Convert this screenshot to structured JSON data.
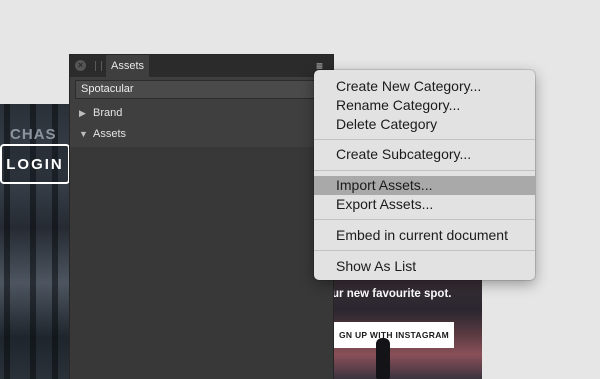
{
  "background": {
    "left_sign": "CHAS",
    "login_label": "LOGIN",
    "tagline": "ur new favourite spot.",
    "instagram_button": "GN UP WITH INSTAGRAM"
  },
  "panel": {
    "tab_label": "Assets",
    "category": "Spotacular",
    "items": [
      {
        "label": "Brand",
        "expanded": false
      },
      {
        "label": "Assets",
        "expanded": true
      }
    ],
    "colors": {
      "panel_bg": "#3f3f3f",
      "header_bg": "#2b2b2b"
    }
  },
  "menu": {
    "items": [
      {
        "label": "Create New Category..."
      },
      {
        "label": "Rename Category..."
      },
      {
        "label": "Delete Category"
      },
      {
        "label": "Create Subcategory..."
      },
      {
        "label": "Import Assets...",
        "highlighted": true
      },
      {
        "label": "Export Assets..."
      },
      {
        "label": "Embed in current document"
      },
      {
        "label": "Show As List"
      }
    ],
    "colors": {
      "highlight": "#a9a9a9",
      "bg": "#e2e2e2"
    }
  }
}
